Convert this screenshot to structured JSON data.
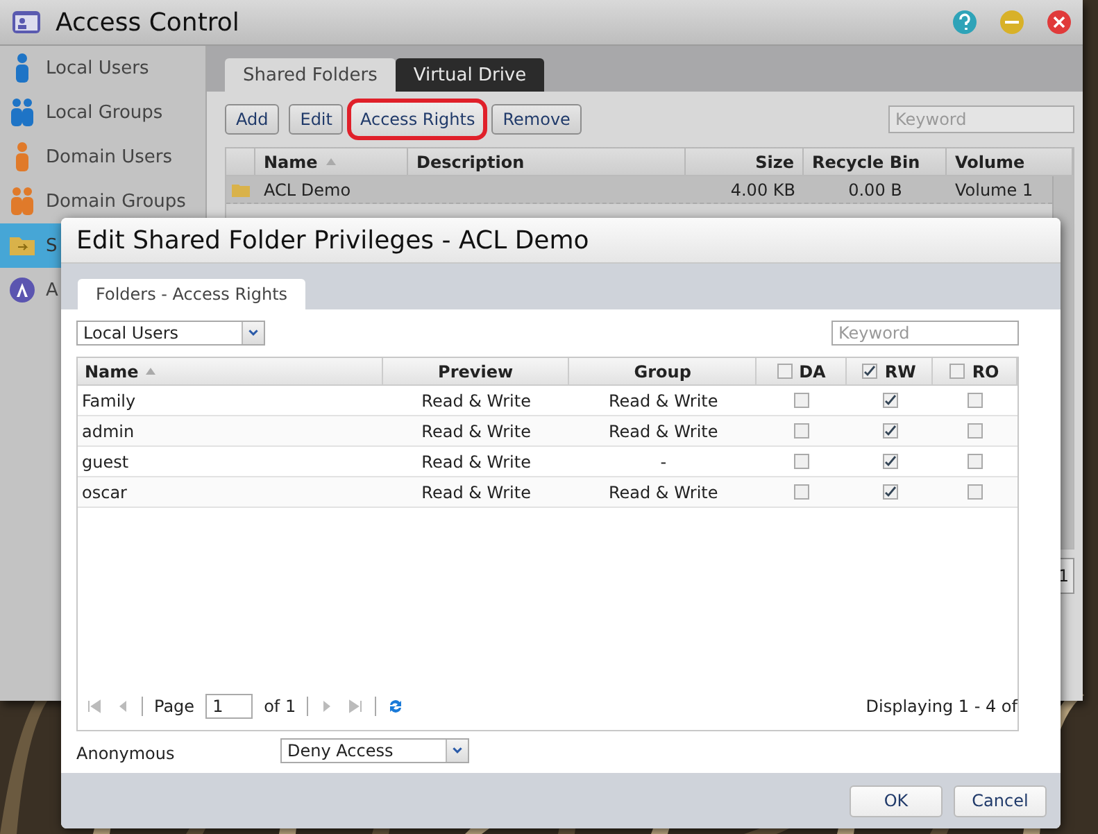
{
  "window": {
    "title": "Access Control"
  },
  "sidebar": {
    "items": [
      {
        "label": "Local Users",
        "selected": false,
        "kind": "user"
      },
      {
        "label": "Local Groups",
        "selected": false,
        "kind": "group"
      },
      {
        "label": "Domain Users",
        "selected": false,
        "kind": "domain-user"
      },
      {
        "label": "Domain Groups",
        "selected": false,
        "kind": "domain-group"
      },
      {
        "label": "S",
        "selected": true,
        "kind": "folder"
      },
      {
        "label": "A",
        "selected": false,
        "kind": "app"
      }
    ]
  },
  "tabs": [
    {
      "label": "Shared Folders",
      "selected": true
    },
    {
      "label": "Virtual Drive",
      "selected": false
    }
  ],
  "toolbar": {
    "buttons": [
      {
        "label": "Add",
        "highlighted": false
      },
      {
        "label": "Edit",
        "highlighted": false
      },
      {
        "label": "Access Rights",
        "highlighted": true
      },
      {
        "label": "Remove",
        "highlighted": false
      }
    ],
    "search": {
      "placeholder": "Keyword"
    }
  },
  "folder_table": {
    "columns": [
      {
        "label": "Name",
        "sorted": true
      },
      {
        "label": "Description",
        "sorted": false
      },
      {
        "label": "Size",
        "sorted": false
      },
      {
        "label": "Recycle Bin",
        "sorted": false
      },
      {
        "label": "Volume",
        "sorted": false
      }
    ],
    "rows": [
      {
        "name": "ACL Demo",
        "size": "4.00 KB",
        "recycle_bin": "0.00 B",
        "volume": "Volume 1",
        "selected": true
      }
    ],
    "pager_fragment": "1"
  },
  "dialog": {
    "title": "Edit Shared Folder Privileges - ACL Demo",
    "tabs": [
      {
        "label": "Folders - Access Rights",
        "selected": true
      }
    ],
    "filter": {
      "value": "Local Users"
    },
    "search": {
      "placeholder": "Keyword"
    },
    "columns": [
      {
        "label": "Name",
        "kind": "text",
        "sorted": true
      },
      {
        "label": "Preview",
        "kind": "text",
        "sorted": false
      },
      {
        "label": "Group",
        "kind": "text",
        "sorted": false
      },
      {
        "label": "DA",
        "kind": "check",
        "sorted": false,
        "checked": false
      },
      {
        "label": "RW",
        "kind": "check",
        "sorted": false,
        "checked": true
      },
      {
        "label": "RO",
        "kind": "check",
        "sorted": false,
        "checked": false
      }
    ],
    "rows": [
      {
        "name": "Family",
        "preview": "Read & Write",
        "group": "Read & Write",
        "da": false,
        "rw": true,
        "ro": false
      },
      {
        "name": "admin",
        "preview": "Read & Write",
        "group": "Read & Write",
        "da": false,
        "rw": true,
        "ro": false
      },
      {
        "name": "guest",
        "preview": "Read & Write",
        "group": "-",
        "da": false,
        "rw": true,
        "ro": false
      },
      {
        "name": "oscar",
        "preview": "Read & Write",
        "group": "Read & Write",
        "da": false,
        "rw": true,
        "ro": false
      }
    ],
    "pager": {
      "page_label": "Page",
      "page": "1",
      "of": "of 1",
      "summary": "Displaying 1 - 4 of"
    },
    "anonymous": {
      "label": "Anonymous",
      "value": "Deny Access"
    },
    "buttons": [
      "OK",
      "Cancel"
    ]
  }
}
